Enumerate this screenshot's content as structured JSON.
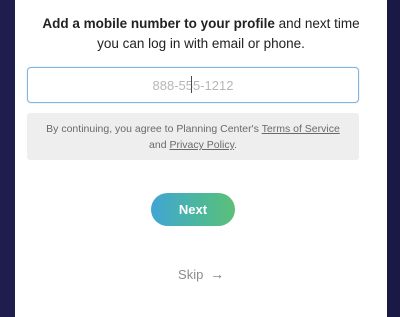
{
  "heading": {
    "bold_part": "Add a mobile number to your profile",
    "rest": " and next time you can log in with email or phone."
  },
  "phone": {
    "placeholder": "888-555-1212",
    "value": ""
  },
  "notice": {
    "prefix": "By continuing, you agree to Planning Center's ",
    "terms_link": "Terms of Service",
    "middle": " and ",
    "privacy_link": "Privacy Policy",
    "suffix": "."
  },
  "actions": {
    "next_label": "Next",
    "skip_label": "Skip",
    "skip_icon": "→"
  },
  "colors": {
    "background": "#1e1d4e",
    "input_border": "#84b3de",
    "button_gradient_start": "#41a5d4",
    "button_gradient_end": "#5cbf78"
  }
}
